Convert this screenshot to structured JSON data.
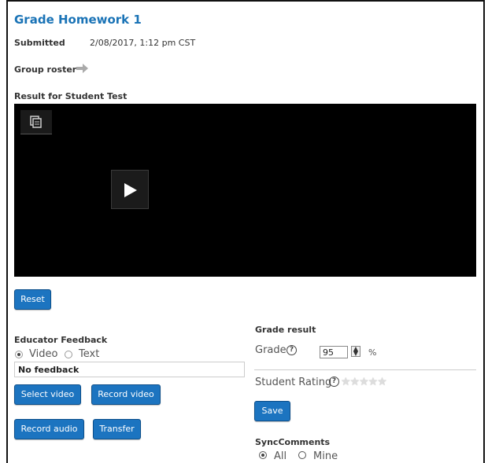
{
  "page_title": "Grade Homework 1",
  "submitted": {
    "label": "Submitted",
    "value": "2/08/2017, 1:12 pm CST"
  },
  "group_roster": {
    "label": "Group roster",
    "icon": "arrow-right-icon"
  },
  "result_label": "Result for Student Test",
  "reset_label": "Reset",
  "educator_feedback": {
    "heading": "Educator Feedback",
    "options": [
      "Video",
      "Text"
    ],
    "selected": "Video",
    "feedback_value": "No feedback",
    "select_video_label": "Select video",
    "record_video_label": "Record video",
    "record_audio_label": "Record audio",
    "transfer_label": "Transfer"
  },
  "grade_result": {
    "heading": "Grade result",
    "grade_label": "Grade",
    "grade_value": "95",
    "unit": "%",
    "student_rating_label": "Student Rating",
    "rating": 0,
    "rating_max": 5,
    "save_label": "Save"
  },
  "sync_comments": {
    "heading": "SyncComments",
    "options": [
      "All",
      "Mine"
    ],
    "selected": "All"
  },
  "colors": {
    "title": "#1a73b6",
    "button": "#1c74c0"
  }
}
